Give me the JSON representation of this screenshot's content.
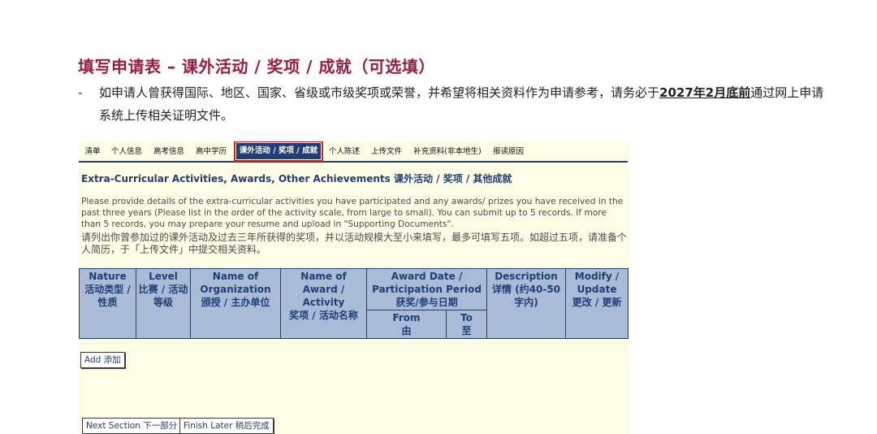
{
  "page": {
    "title": "填写申请表 – 课外活动 / 奖项 / 成就（可选填）",
    "bullet_dash": "-",
    "bullet_text_1": "如申请人曾获得国际、地区、国家、省级或市级奖项或荣誉，并希望将相关资料作为申请参考，请务必于",
    "bullet_deadline": "2027年2月底前",
    "bullet_text_2": "通过网上申请系统上传相关证明文件。"
  },
  "tabs": [
    {
      "label": "清单"
    },
    {
      "label": "个人信息"
    },
    {
      "label": "高考信息"
    },
    {
      "label": "高中学历"
    },
    {
      "label": "课外活动 / 奖项 / 成就",
      "active": true
    },
    {
      "label": "个人陈述"
    },
    {
      "label": "上传文件"
    },
    {
      "label": "补充资料(非本地生)"
    },
    {
      "label": "报读原因"
    }
  ],
  "section": {
    "heading": "Extra-Curricular Activities, Awards, Other Achievements 课外活动 / 奖项 / 其他成就",
    "instructions_en": "Please provide details of the extra-curricular activities you have participated and any awards/ prizes you have received in the past three years (Please list in the order of the activity scale, from large to small). You can submit up to 5 records. If more than 5 records, you may prepare your resume and upload in \"Supporting Documents\".",
    "instructions_zh": "请列出你曾参加过的课外活动及过去三年所获得的奖项，并以活动规模大至小来填写，最多可填写五项。如超过五项，请准备个人简历，于「上传文件」中提交相关资料。"
  },
  "table": {
    "nature_en": "Nature",
    "nature_zh": "活动类型 / 性质",
    "level_en": "Level",
    "level_zh": "比赛 / 活动等级",
    "org_en": "Name of Organization",
    "org_zh": "颁授 / 主办单位",
    "award_en": "Name of Award / Activity",
    "award_zh": "奖项 / 活动名称",
    "date_en": "Award Date / Participation Period",
    "date_zh": "获奖/参与日期",
    "from_en": "From",
    "from_zh": "由",
    "to_en": "To",
    "to_zh": "至",
    "desc_en": "Description",
    "desc_zh": "详情 (约40-50字内)",
    "modify_en": "Modify / Update",
    "modify_zh": "更改 / 更新"
  },
  "buttons": {
    "add": "Add 添加",
    "next": "Next Section 下一部分",
    "finish": "Finish Later 稍后完成"
  },
  "colors": {
    "title": "#9b1c42",
    "navy": "#1f3f75",
    "header_bg": "#a9bbd6",
    "form_bg": "#fcfde4",
    "highlight": "#d42020"
  }
}
